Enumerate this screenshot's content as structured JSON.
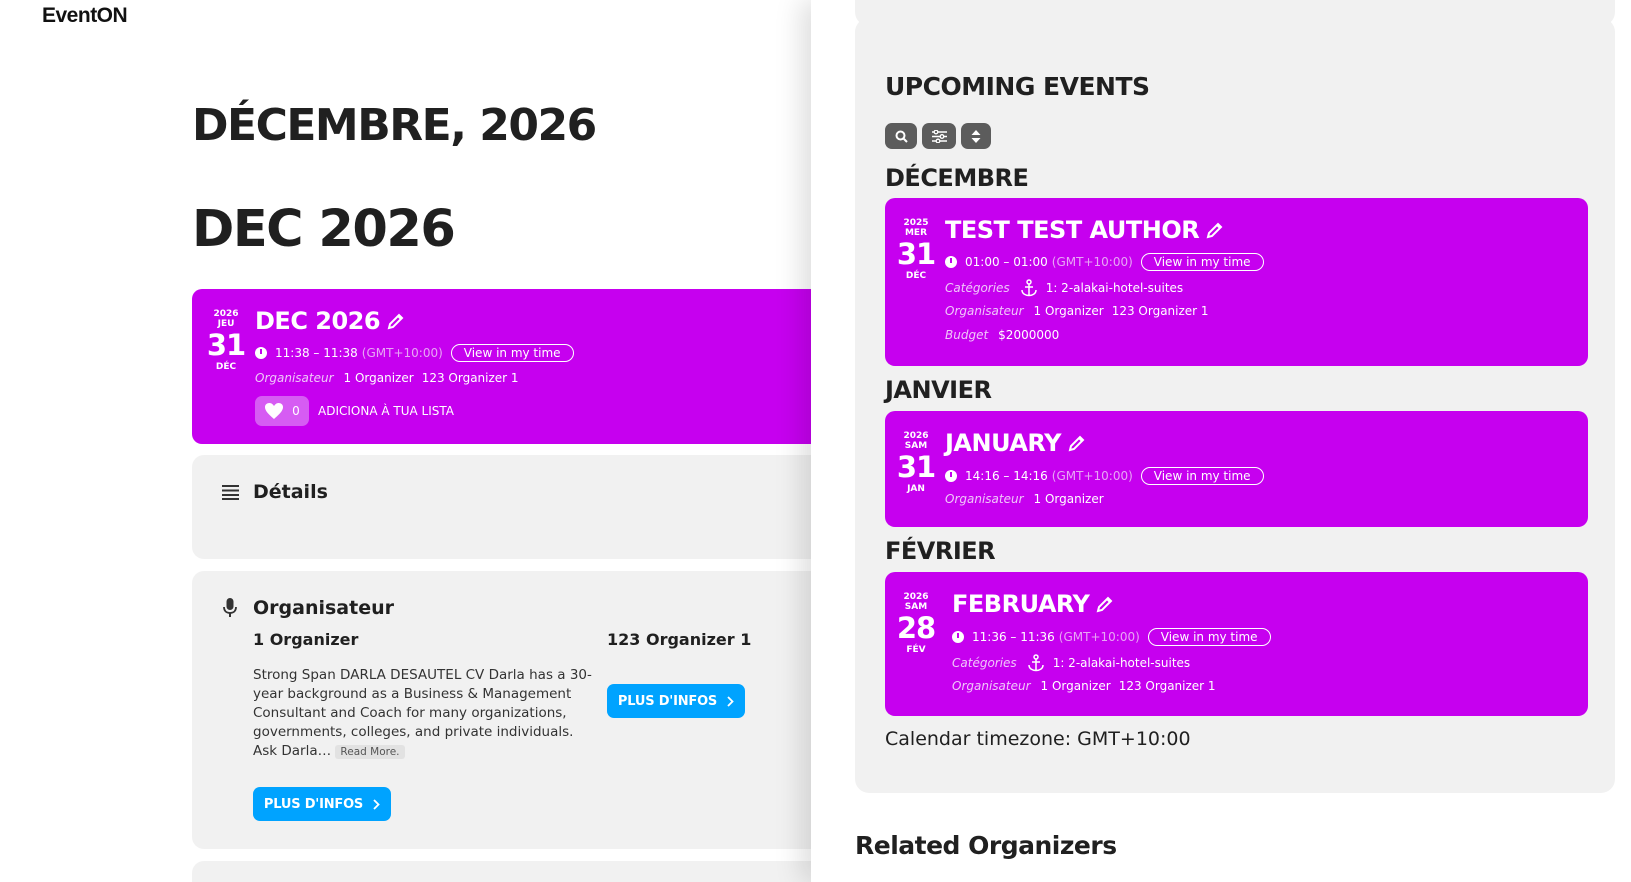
{
  "site": {
    "logo": "EventON"
  },
  "page": {
    "month_heading": "DÉCEMBRE, 2026",
    "event_heading": "DEC 2026"
  },
  "main_event": {
    "year": "2026",
    "weekday": "JEU",
    "day": "31",
    "month": "DÉC",
    "title": "DEC 2026",
    "time": "11:38 – 11:38",
    "tz": "(GMT+10:00)",
    "view_time": "View in my time",
    "organizer_label": "Organisateur",
    "organizers": [
      "1 Organizer",
      "123 Organizer 1"
    ],
    "wishlist_count": "0",
    "wishlist_label": "ADICIONA À TUA LISTA"
  },
  "details": {
    "title": "Détails"
  },
  "organizer_section": {
    "title": "Organisateur",
    "org1": {
      "name": "1 Organizer",
      "bio": "Strong Span DARLA DESAUTEL CV Darla has a 30-year background as a Business & Management Consultant and Coach for many organizations, governments, colleges, and private individuals. Ask Darla…",
      "read_more": "Read More.",
      "button": "PLUS D'INFOS"
    },
    "org2": {
      "name": "123 Organizer 1",
      "button": "PLUS D'INFOS"
    }
  },
  "sidebar": {
    "title": "UPCOMING EVENTS",
    "months": [
      "DÉCEMBRE",
      "JANVIER",
      "FÉVRIER"
    ],
    "events": [
      {
        "year": "2025",
        "weekday": "MER",
        "day": "31",
        "month": "DÉC",
        "title": "TEST TEST AUTHOR",
        "time": "01:00 – 01:00",
        "tz": "(GMT+10:00)",
        "view_time": "View in my time",
        "categories_label": "Catégories",
        "category": "1: 2-alakai-hotel-suites",
        "organizer_label": "Organisateur",
        "organizers": [
          "1 Organizer",
          "123 Organizer 1"
        ],
        "budget_label": "Budget",
        "budget": "$2000000"
      },
      {
        "year": "2026",
        "weekday": "SAM",
        "day": "31",
        "month": "JAN",
        "title": "JANUARY",
        "time": "14:16 – 14:16",
        "tz": "(GMT+10:00)",
        "view_time": "View in my time",
        "organizer_label": "Organisateur",
        "organizers": [
          "1 Organizer"
        ]
      },
      {
        "year": "2026",
        "weekday": "SAM",
        "day": "28",
        "month": "FÉV",
        "title": "FEBRUARY",
        "time": "11:36 – 11:36",
        "tz": "(GMT+10:00)",
        "view_time": "View in my time",
        "categories_label": "Catégories",
        "category": "1: 2-alakai-hotel-suites",
        "organizer_label": "Organisateur",
        "organizers": [
          "1 Organizer",
          "123 Organizer 1"
        ]
      }
    ],
    "timezone_note": "Calendar timezone: GMT+10:00",
    "related_title": "Related Organizers"
  }
}
